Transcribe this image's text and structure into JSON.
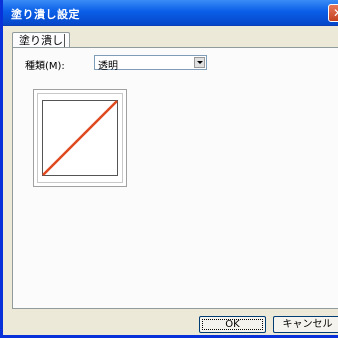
{
  "window": {
    "title": "塗り潰し設定",
    "close_glyph": "✕"
  },
  "tabs": [
    {
      "label": "塗り潰し"
    }
  ],
  "fill_type": {
    "label": "種類(M):",
    "value": "透明"
  },
  "preview": {
    "type": "transparent",
    "slash_color": "#e0481e"
  },
  "buttons": {
    "ok": "OK",
    "cancel": "キャンセル"
  },
  "colors": {
    "titlebar": "#0a5fe8",
    "dialog_bg": "#ece9d8"
  }
}
